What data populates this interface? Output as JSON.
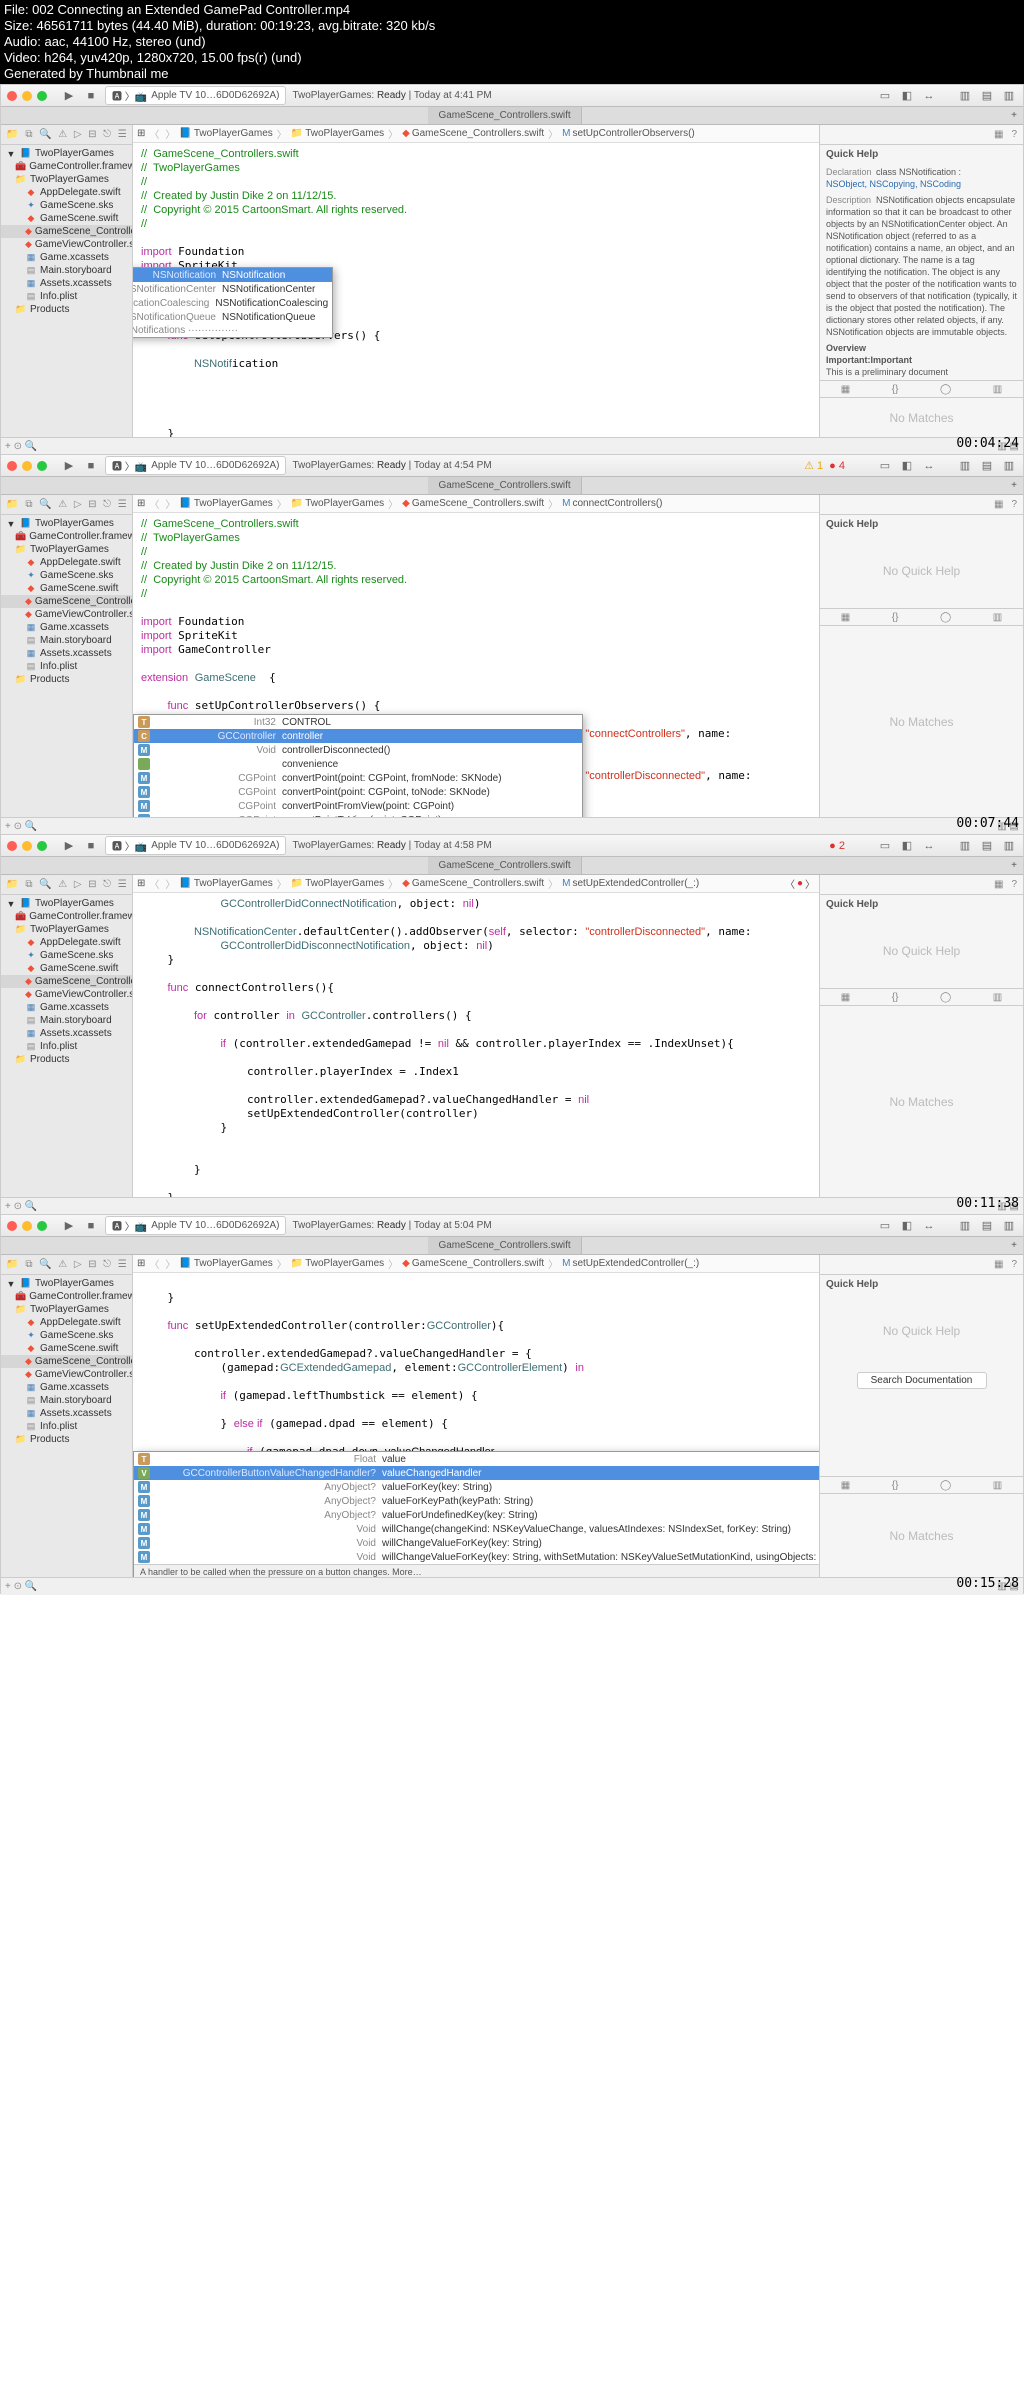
{
  "file_info": {
    "l1": "File: 002 Connecting an Extended GamePad Controller.mp4",
    "l2": "Size: 46561711 bytes (44.40 MiB), duration: 00:19:23, avg.bitrate: 320 kb/s",
    "l3": "Audio: aac, 44100 Hz, stereo (und)",
    "l4": "Video: h264, yuv420p, 1280x720, 15.00 fps(r) (und)",
    "l5": "Generated by Thumbnail me"
  },
  "device": "Apple TV 10…6D0D62692A)",
  "scheme_status_prefix": "TwoPlayerGames:",
  "ready": "Ready",
  "frames": [
    {
      "time": "Today at 4:41 PM",
      "ts": "00:04:24",
      "tab": "GameScene_Controllers.swift",
      "crumb": [
        "TwoPlayerGames",
        "TwoPlayerGames",
        "GameScene_Controllers.swift",
        "setUpControllerObservers()"
      ],
      "warn": null,
      "err": null,
      "quickhelp": true,
      "qh_decl": "class NSNotification :",
      "qh_decl2": "NSObject, NSCopying, NSCoding",
      "qh_desc": "NSNotification objects encapsulate information so that it can be broadcast to other objects by an NSNotificationCenter object. An NSNotification object (referred to as a notification) contains a name, an object, and an optional dictionary. The name is a tag identifying the notification. The object is any object that the poster of the notification wants to send to observers of that notification (typically, it is the object that posted the notification). The dictionary stores other related objects, if any. NSNotification objects are immutable objects.",
      "qh_over": "Overview",
      "qh_imp": "Important:Important",
      "qh_note": "This is a preliminary document"
    },
    {
      "time": "Today at 4:54 PM",
      "ts": "00:07:44",
      "tab": "GameScene_Controllers.swift",
      "crumb": [
        "TwoPlayerGames",
        "TwoPlayerGames",
        "GameScene_Controllers.swift",
        "connectControllers()"
      ],
      "warn": "1",
      "err": "4",
      "quickhelp": false
    },
    {
      "time": "Today at 4:58 PM",
      "ts": "00:11:38",
      "tab": "GameScene_Controllers.swift",
      "crumb": [
        "TwoPlayerGames",
        "TwoPlayerGames",
        "GameScene_Controllers.swift",
        "setUpExtendedController(_:)"
      ],
      "warn": null,
      "err": "2",
      "quickhelp": false,
      "crumb_err": true
    },
    {
      "time": "Today at 5:04 PM",
      "ts": "00:15:28",
      "tab": "GameScene_Controllers.swift",
      "crumb": [
        "TwoPlayerGames",
        "TwoPlayerGames",
        "GameScene_Controllers.swift",
        "setUpExtendedController(_:)"
      ],
      "warn": null,
      "err": null,
      "quickhelp": false,
      "searchdoc": true
    }
  ],
  "sidebar": {
    "root": "TwoPlayerGames",
    "items": [
      {
        "name": "GameController.framework",
        "icon": "fw",
        "ind": 1
      },
      {
        "name": "TwoPlayerGames",
        "icon": "folder",
        "ind": 1
      },
      {
        "name": "AppDelegate.swift",
        "icon": "swift",
        "ind": 2
      },
      {
        "name": "GameScene.sks",
        "icon": "sks",
        "ind": 2
      },
      {
        "name": "GameScene.swift",
        "icon": "swift",
        "ind": 2
      },
      {
        "name": "GameScene_Controllers.swift",
        "icon": "swift",
        "ind": 2,
        "sel": true
      },
      {
        "name": "GameViewController.swift",
        "icon": "swift",
        "ind": 2
      },
      {
        "name": "Game.xcassets",
        "icon": "xc",
        "ind": 2
      },
      {
        "name": "Main.storyboard",
        "icon": "sb",
        "ind": 2
      },
      {
        "name": "Assets.xcassets",
        "icon": "xc",
        "ind": 2
      },
      {
        "name": "Info.plist",
        "icon": "plist",
        "ind": 2
      },
      {
        "name": "Products",
        "icon": "folder",
        "ind": 1
      }
    ]
  },
  "no_matches": "No Matches",
  "no_quick_help": "No Quick Help",
  "quick_help_title": "Quick Help",
  "search_doc": "Search Documentation",
  "code1_header": "//  GameScene_Controllers.swift\n//  TwoPlayerGames\n//\n//  Created by Justin Dike 2 on 11/12/15.\n//  Copyright © 2015 CartoonSmart. All rights reserved.\n//",
  "code1_imports": [
    "import Foundation",
    "import SpriteKit",
    "import GameController"
  ],
  "ac1": {
    "header_notif": "Notifications",
    "rows": [
      {
        "b": "C",
        "t": "NSNotification",
        "n": "NSNotification",
        "sel": true
      },
      {
        "b": "C",
        "t": "NSNotificationCenter",
        "n": "NSNotificationCenter"
      },
      {
        "b": "S",
        "t": "NSNotificationCoalescing",
        "n": "NSNotificationCoalescing"
      },
      {
        "b": "C",
        "t": "NSNotificationQueue",
        "n": "NSNotificationQueue"
      }
    ]
  },
  "ac2": {
    "rows": [
      {
        "b": "T",
        "t": "Int32",
        "n": "CONTROL"
      },
      {
        "b": "C",
        "t": "GCController",
        "n": "controller",
        "sel": true
      },
      {
        "b": "M",
        "t": "Void",
        "n": "controllerDisconnected()"
      },
      {
        "b": " ",
        "t": "",
        "n": "convenience"
      },
      {
        "b": "M",
        "t": "CGPoint",
        "n": "convertPoint(point: CGPoint, fromNode: SKNode)"
      },
      {
        "b": "M",
        "t": "CGPoint",
        "n": "convertPoint(point: CGPoint, toNode: SKNode)"
      },
      {
        "b": "M",
        "t": "CGPoint",
        "n": "convertPointFromView(point: CGPoint)"
      },
      {
        "b": "M",
        "t": "CGPoint",
        "n": "convertPointToView(point: CGPoint)"
      }
    ]
  },
  "ac4": {
    "rows": [
      {
        "b": "T",
        "t": "Float",
        "n": "value"
      },
      {
        "b": "V",
        "t": "GCControllerButtonValueChangedHandler?",
        "n": "valueChangedHandler",
        "sel": true
      },
      {
        "b": "M",
        "t": "AnyObject?",
        "n": "valueForKey(key: String)"
      },
      {
        "b": "M",
        "t": "AnyObject?",
        "n": "valueForKeyPath(keyPath: String)"
      },
      {
        "b": "M",
        "t": "AnyObject?",
        "n": "valueForUndefinedKey(key: String)"
      },
      {
        "b": "M",
        "t": "Void",
        "n": "willChange(changeKind: NSKeyValueChange, valuesAtIndexes: NSIndexSet, forKey: String)"
      },
      {
        "b": "M",
        "t": "Void",
        "n": "willChangeValueForKey(key: String)"
      },
      {
        "b": "M",
        "t": "Void",
        "n": "willChangeValueForKey(key: String, withSetMutation: NSKeyValueSetMutationKind, usingObjects: Set<NSObject>)"
      }
    ],
    "help": "A handler to be called when the pressure on a button changes. More…"
  }
}
